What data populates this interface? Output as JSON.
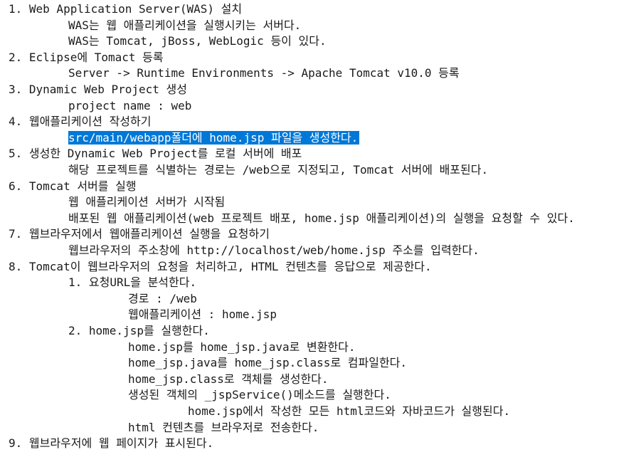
{
  "lines": [
    {
      "indent": 0,
      "text": "1. Web Application Server(WAS) 설치"
    },
    {
      "indent": 1,
      "text": "WAS는 웹 애플리케이션을 실행시키는 서버다."
    },
    {
      "indent": 1,
      "text": "WAS는 Tomcat, jBoss, WebLogic 등이 있다."
    },
    {
      "indent": 0,
      "text": "2. Eclipse에 Tomact 등록"
    },
    {
      "indent": 1,
      "text": "Server -> Runtime Environments -> Apache Tomcat v10.0 등록"
    },
    {
      "indent": 0,
      "text": "3. Dynamic Web Project 생성"
    },
    {
      "indent": 1,
      "text": "project name : web"
    },
    {
      "indent": 0,
      "text": "4. 웹애플리케이션 작성하기"
    },
    {
      "indent": 1,
      "text": "src/main/webapp폴더에 home.jsp 파일을 생성한다.",
      "selected": true
    },
    {
      "indent": 0,
      "text": "5. 생성한 Dynamic Web Project를 로컬 서버에 배포"
    },
    {
      "indent": 1,
      "text": "해당 프로젝트를 식별하는 경로는 /web으로 지정되고, Tomcat 서버에 배포된다."
    },
    {
      "indent": 0,
      "text": "6. Tomcat 서버를 실행"
    },
    {
      "indent": 1,
      "text": "웹 애플리케이션 서버가 시작됨"
    },
    {
      "indent": 1,
      "text": "배포된 웹 애플리케이션(web 프로젝트 배포, home.jsp 애플리케이션)의 실행을 요청할 수 있다."
    },
    {
      "indent": 0,
      "text": "7. 웹브라우저에서 웹애플리케이션 실행을 요청하기"
    },
    {
      "indent": 1,
      "text": "웹브라우저의 주소창에 http://localhost/web/home.jsp 주소를 입력한다."
    },
    {
      "indent": 0,
      "text": "8. Tomcat이 웹브라우저의 요청을 처리하고, HTML 컨텐츠를 응답으로 제공한다."
    },
    {
      "indent": 1,
      "text": "1. 요청URL을 분석한다."
    },
    {
      "indent": 2,
      "text": "경로 : /web"
    },
    {
      "indent": 2,
      "text": "웹애플리케이션 : home.jsp"
    },
    {
      "indent": 1,
      "text": "2. home.jsp를 실행한다."
    },
    {
      "indent": 2,
      "text": "home.jsp를 home_jsp.java로 변환한다."
    },
    {
      "indent": 2,
      "text": "home_jsp.java를 home_jsp.class로 컴파일한다."
    },
    {
      "indent": 2,
      "text": "home_jsp.class로 객체를 생성한다."
    },
    {
      "indent": 2,
      "text": "생성된 객체의 _jspService()메소드를 실행한다."
    },
    {
      "indent": 3,
      "text": "home.jsp에서 작성한 모든 html코드와 자바코드가 실행된다."
    },
    {
      "indent": 2,
      "text": "html 컨텐츠를 브라우저로 전송한다."
    },
    {
      "indent": 0,
      "text": "9. 웹브라우저에 웹 페이지가 표시된다."
    }
  ]
}
